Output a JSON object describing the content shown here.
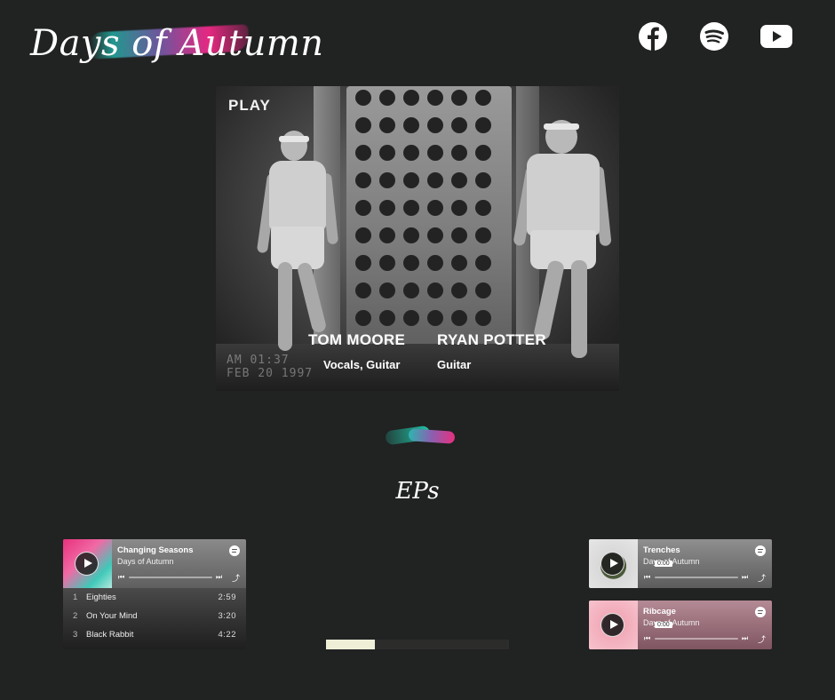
{
  "header": {
    "logo_text": "Days of Autumn",
    "social": [
      {
        "name": "facebook-icon",
        "color": "#ffffff"
      },
      {
        "name": "spotify-icon",
        "color": "#ffffff"
      },
      {
        "name": "youtube-icon",
        "color": "#ffffff"
      }
    ]
  },
  "hero": {
    "play_label": "PLAY",
    "stamp_time": "AM 01:37",
    "stamp_date": "FEB 20 1997",
    "members": [
      {
        "name": "TOM MOORE",
        "role": "Vocals, Guitar"
      },
      {
        "name": "RYAN POTTER",
        "role": "Guitar"
      }
    ]
  },
  "eps": {
    "title": "EPs",
    "players": [
      {
        "title": "Changing Seasons",
        "artist": "Days of Autumn",
        "art_colors": [
          "#e8317d",
          "#3fc9b8"
        ],
        "tracks": [
          {
            "num": "1",
            "title": "Eighties",
            "duration": "2:59"
          },
          {
            "num": "2",
            "title": "On Your Mind",
            "duration": "3:20"
          },
          {
            "num": "3",
            "title": "Black Rabbit",
            "duration": "4:22"
          }
        ]
      },
      {
        "title": "Trenches",
        "artist": "Days of Autumn",
        "time": "0:00",
        "art_colors": [
          "#d8d8d8",
          "#4b5a3a"
        ]
      },
      {
        "title": "Ribcage",
        "artist": "Days of Autumn",
        "time": "0:00",
        "art_colors": [
          "#f2a9b8",
          "#9a5a6a"
        ]
      }
    ]
  },
  "colors": {
    "background": "#212222",
    "accent_pink": "#e5307f",
    "accent_teal": "#20c2a5"
  }
}
